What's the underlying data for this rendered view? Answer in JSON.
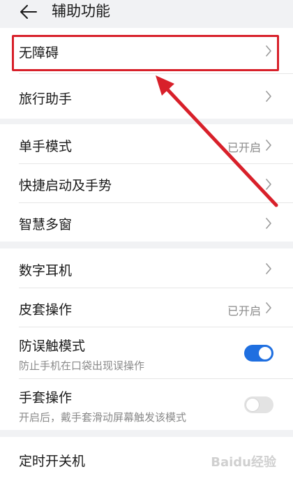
{
  "header": {
    "title": "辅助功能"
  },
  "groups": [
    {
      "items": [
        {
          "label": "无障碍",
          "status": ""
        },
        {
          "label": "旅行助手",
          "status": ""
        }
      ]
    },
    {
      "items": [
        {
          "label": "单手模式",
          "status": "已开启"
        },
        {
          "label": "快捷启动及手势",
          "status": ""
        },
        {
          "label": "智慧多窗",
          "status": ""
        }
      ]
    },
    {
      "items": [
        {
          "label": "数字耳机",
          "status": ""
        },
        {
          "label": "皮套操作",
          "status": "已开启"
        },
        {
          "label": "防误触模式",
          "subtitle": "防止手机在口袋出现误操作",
          "toggle": true
        },
        {
          "label": "手套操作",
          "subtitle": "开启后，戴手套滑动屏幕触发该模式",
          "toggle": false
        }
      ]
    },
    {
      "items": [
        {
          "label": "定时开关机",
          "status": ""
        }
      ]
    }
  ],
  "watermark": {
    "text": "Baidu经验"
  },
  "colors": {
    "accent": "#1f6fe0",
    "annotation": "#d8202a",
    "background": "#f1f2f4"
  },
  "icons": {
    "back": "arrow-left-icon",
    "chevron": "chevron-right-icon"
  }
}
